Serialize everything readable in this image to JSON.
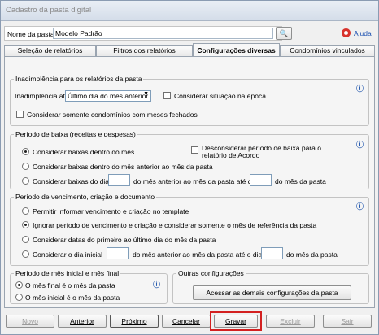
{
  "window": {
    "title": "Cadastro da pasta digital"
  },
  "header": {
    "folder_name_label": "Nome da pasta:",
    "folder_name_value": "Modelo Padrão",
    "help_label": "Ajuda"
  },
  "tabs": [
    {
      "label": "Seleção de relatórios"
    },
    {
      "label": "Filtros dos relatórios"
    },
    {
      "label": "Configurações diversas"
    },
    {
      "label": "Condomínios vinculados"
    }
  ],
  "inadimplencia": {
    "title": "Inadimplência para os relatórios da pasta",
    "until_label": "Inadimplência até",
    "until_value": "Último dia do mês anterior",
    "consider_epoch_label": "Considerar situação na época",
    "only_closed_label": "Considerar somente condomínios com meses fechados"
  },
  "baixa": {
    "title": "Período de baixa (receitas e despesas)",
    "opt1": "Considerar baixas dentro do mês",
    "disregard_label": "Desconsiderar período de baixa para o relatório de Acordo",
    "disregard_line1": "Desconsiderar período de baixa para o",
    "disregard_line2": "relatório de Acordo",
    "opt2": "Considerar baixas dentro do mês anterior ao mês da pasta",
    "opt3_prefix": "Considerar baixas do dia",
    "opt3_mid": "do mês anterior ao mês da pasta até dia",
    "opt3_suffix": "do mês da pasta"
  },
  "vencimento": {
    "title": "Período de vencimento, criação e documento",
    "opt1": "Permitir informar vencimento e criação no template",
    "opt2": "Ignorar período de vencimento e criação e considerar somente o mês de referência da pasta",
    "opt3": "Considerar datas do primeiro ao último dia do mês da pasta",
    "opt4_prefix": "Considerar o dia inicial",
    "opt4_mid": "do mês anterior ao mês da pasta até o dia",
    "opt4_suffix": "do mês da pasta"
  },
  "periodo_mes": {
    "title": "Período de mês inicial e mês final",
    "opt1": "O mês final é o mês da pasta",
    "opt2": "O mês inicial é o mês da pasta"
  },
  "outras": {
    "title": "Outras configurações",
    "button": "Acessar as demais configurações da pasta"
  },
  "footer": {
    "novo": "Novo",
    "anterior": "Anterior",
    "proximo": "Próximo",
    "cancelar": "Cancelar",
    "gravar": "Gravar",
    "excluir": "Excluir",
    "sair": "Sair"
  }
}
